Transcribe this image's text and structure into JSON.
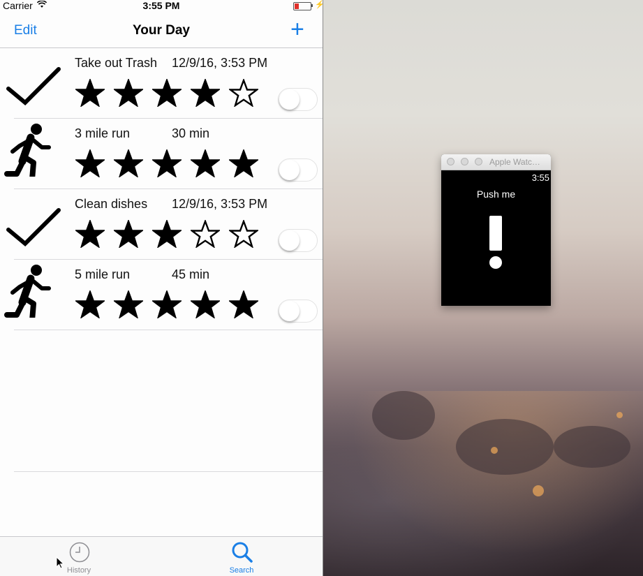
{
  "status_bar": {
    "carrier": "Carrier",
    "time": "3:55 PM",
    "battery_level": 0.25
  },
  "nav": {
    "edit_label": "Edit",
    "title": "Your Day",
    "add_label": "+"
  },
  "rows": [
    {
      "icon": "checkmark-icon",
      "title": "Take out Trash",
      "meta": "12/9/16, 3:53 PM",
      "rating": 4,
      "toggle_on": false
    },
    {
      "icon": "runner-icon",
      "title": "3 mile run",
      "meta": "30 min",
      "rating": 5,
      "toggle_on": false
    },
    {
      "icon": "checkmark-icon",
      "title": "Clean dishes",
      "meta": "12/9/16, 3:53 PM",
      "rating": 3,
      "toggle_on": false
    },
    {
      "icon": "runner-icon",
      "title": "5 mile run",
      "meta": "45 min",
      "rating": 5,
      "toggle_on": false
    }
  ],
  "max_rating": 5,
  "tabs": [
    {
      "label": "History",
      "icon": "clock-icon",
      "selected": false
    },
    {
      "label": "Search",
      "icon": "search-icon",
      "selected": true
    }
  ],
  "watch": {
    "window_title": "Apple Watc…",
    "time": "3:55",
    "button_label": "Push me",
    "page_count": 2,
    "current_page": 1
  },
  "colors": {
    "tint": "#1a7fe6",
    "battery": "#e0302a"
  }
}
